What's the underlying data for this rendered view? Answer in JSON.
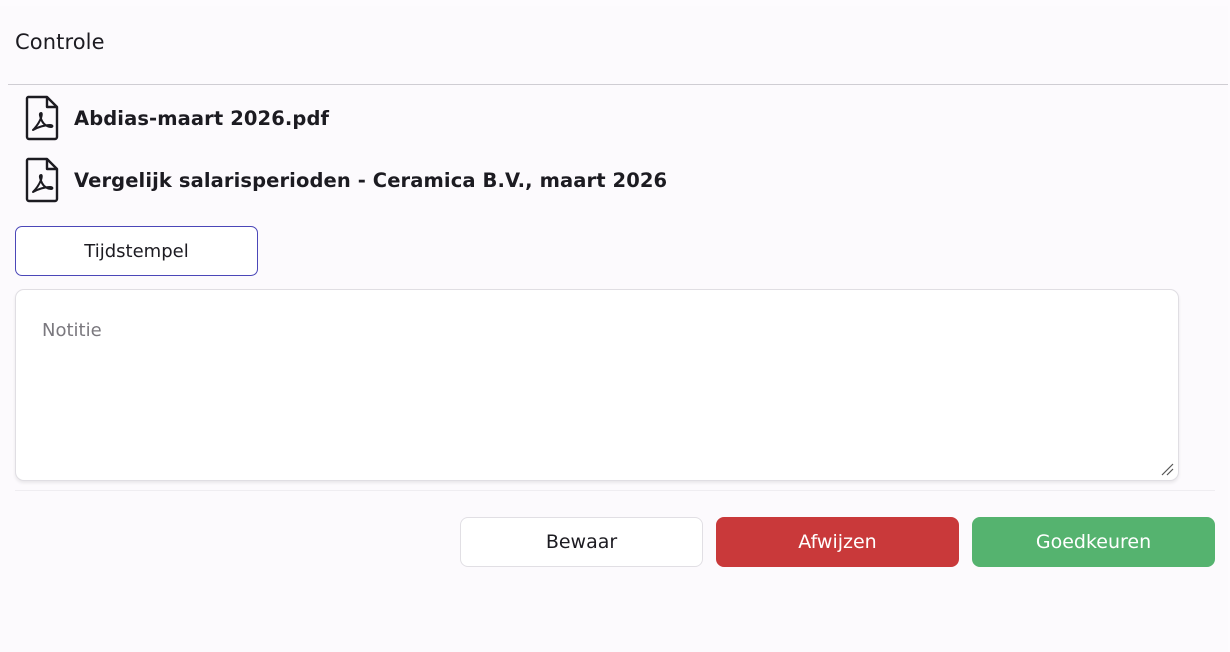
{
  "header": {
    "title": "Controle"
  },
  "files": [
    {
      "name": "Abdias-maart 2026.pdf",
      "icon": "pdf-file-icon"
    },
    {
      "name": "Vergelijk salarisperioden - Ceramica B.V., maart 2026",
      "icon": "pdf-file-icon"
    }
  ],
  "timestamp_button": {
    "label": "Tijdstempel"
  },
  "note": {
    "placeholder": "Notitie",
    "value": ""
  },
  "actions": {
    "save_label": "Bewaar",
    "reject_label": "Afwijzen",
    "approve_label": "Goedkeuren"
  },
  "colors": {
    "reject": "#c9393a",
    "approve": "#55b36f",
    "accent_border": "#4b47b8"
  }
}
